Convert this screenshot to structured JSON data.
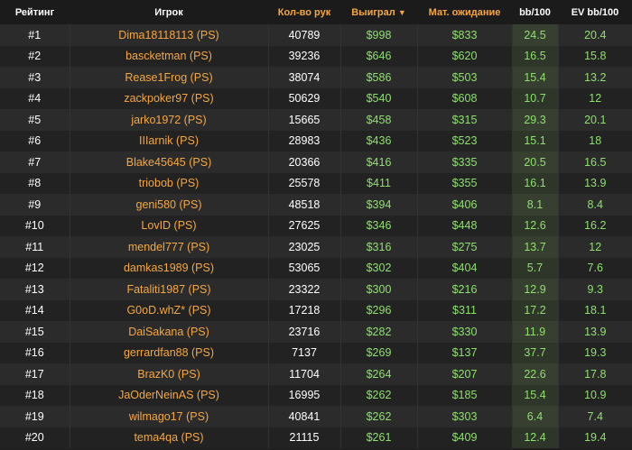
{
  "table": {
    "headers": {
      "rank": "Рейтинг",
      "player": "Игрок",
      "hands": "Кол-во рук",
      "won": "Выиграл",
      "ev": "Мат. ожидание",
      "bb": "bb/100",
      "evbb": "EV bb/100"
    },
    "sort_icon": "caret-down-icon",
    "colors": {
      "accent_orange": "#f5a742",
      "value_green": "#8fe06f",
      "background": "#202020"
    },
    "rows": [
      {
        "rank": "#1",
        "player": "Dima18118113 (PS)",
        "hands": "40789",
        "won": "$998",
        "ev": "$833",
        "bb": "24.5",
        "evbb": "20.4"
      },
      {
        "rank": "#2",
        "player": "bascketman (PS)",
        "hands": "39236",
        "won": "$646",
        "ev": "$620",
        "bb": "16.5",
        "evbb": "15.8"
      },
      {
        "rank": "#3",
        "player": "Rease1Frog (PS)",
        "hands": "38074",
        "won": "$586",
        "ev": "$503",
        "bb": "15.4",
        "evbb": "13.2"
      },
      {
        "rank": "#4",
        "player": "zackpoker97 (PS)",
        "hands": "50629",
        "won": "$540",
        "ev": "$608",
        "bb": "10.7",
        "evbb": "12"
      },
      {
        "rank": "#5",
        "player": "jarko1972 (PS)",
        "hands": "15665",
        "won": "$458",
        "ev": "$315",
        "bb": "29.3",
        "evbb": "20.1"
      },
      {
        "rank": "#6",
        "player": "IIIarnik (PS)",
        "hands": "28983",
        "won": "$436",
        "ev": "$523",
        "bb": "15.1",
        "evbb": "18"
      },
      {
        "rank": "#7",
        "player": "Blake45645 (PS)",
        "hands": "20366",
        "won": "$416",
        "ev": "$335",
        "bb": "20.5",
        "evbb": "16.5"
      },
      {
        "rank": "#8",
        "player": "triobob (PS)",
        "hands": "25578",
        "won": "$411",
        "ev": "$355",
        "bb": "16.1",
        "evbb": "13.9"
      },
      {
        "rank": "#9",
        "player": "geni580 (PS)",
        "hands": "48518",
        "won": "$394",
        "ev": "$406",
        "bb": "8.1",
        "evbb": "8.4"
      },
      {
        "rank": "#10",
        "player": "LovID (PS)",
        "hands": "27625",
        "won": "$346",
        "ev": "$448",
        "bb": "12.6",
        "evbb": "16.2"
      },
      {
        "rank": "#11",
        "player": "mendel777 (PS)",
        "hands": "23025",
        "won": "$316",
        "ev": "$275",
        "bb": "13.7",
        "evbb": "12"
      },
      {
        "rank": "#12",
        "player": "damkas1989 (PS)",
        "hands": "53065",
        "won": "$302",
        "ev": "$404",
        "bb": "5.7",
        "evbb": "7.6"
      },
      {
        "rank": "#13",
        "player": "Fataliti1987 (PS)",
        "hands": "23322",
        "won": "$300",
        "ev": "$216",
        "bb": "12.9",
        "evbb": "9.3"
      },
      {
        "rank": "#14",
        "player": "G0oD.whZ* (PS)",
        "hands": "17218",
        "won": "$296",
        "ev": "$311",
        "bb": "17.2",
        "evbb": "18.1"
      },
      {
        "rank": "#15",
        "player": "DaiSakana (PS)",
        "hands": "23716",
        "won": "$282",
        "ev": "$330",
        "bb": "11.9",
        "evbb": "13.9"
      },
      {
        "rank": "#16",
        "player": "gerrardfan88 (PS)",
        "hands": "7137",
        "won": "$269",
        "ev": "$137",
        "bb": "37.7",
        "evbb": "19.3"
      },
      {
        "rank": "#17",
        "player": "BrazK0 (PS)",
        "hands": "11704",
        "won": "$264",
        "ev": "$207",
        "bb": "22.6",
        "evbb": "17.8"
      },
      {
        "rank": "#18",
        "player": "JaOderNeinAS (PS)",
        "hands": "16995",
        "won": "$262",
        "ev": "$185",
        "bb": "15.4",
        "evbb": "10.9"
      },
      {
        "rank": "#19",
        "player": "wilmago17 (PS)",
        "hands": "40841",
        "won": "$262",
        "ev": "$303",
        "bb": "6.4",
        "evbb": "7.4"
      },
      {
        "rank": "#20",
        "player": "tema4qa (PS)",
        "hands": "21115",
        "won": "$261",
        "ev": "$409",
        "bb": "12.4",
        "evbb": "19.4"
      }
    ]
  }
}
